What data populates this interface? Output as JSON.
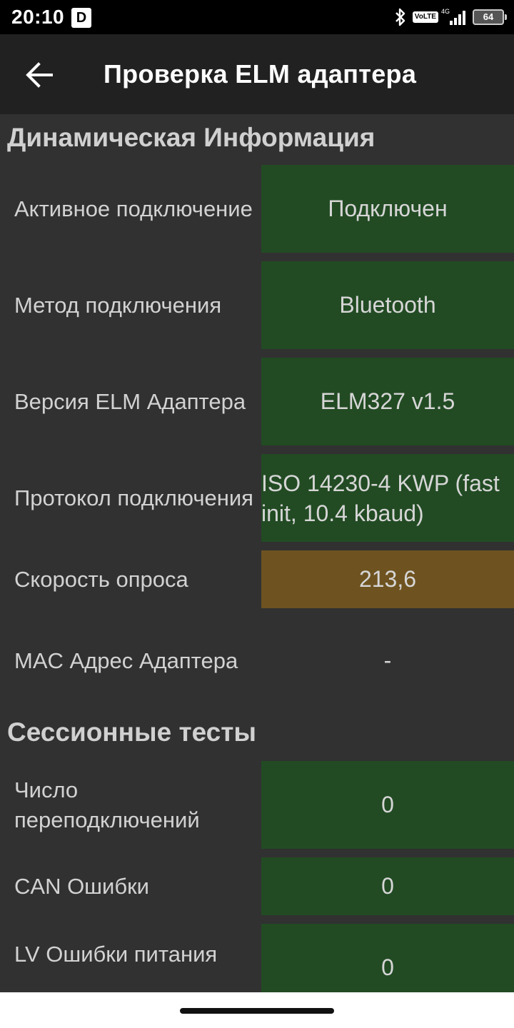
{
  "status_bar": {
    "time": "20:10",
    "notification_letter": "D",
    "volte": "VoLTE",
    "network": "4G",
    "battery": "64"
  },
  "app_bar": {
    "title": "Проверка ELM адаптера"
  },
  "sections": {
    "dynamic": {
      "heading": "Динамическая Информация",
      "rows": [
        {
          "label": "Активное подключение",
          "value": "Подключен"
        },
        {
          "label": "Метод подключения",
          "value": "Bluetooth"
        },
        {
          "label": "Версия ELM Адаптера",
          "value": "ELM327 v1.5"
        },
        {
          "label": "Протокол подключения",
          "value": "ISO 14230-4 KWP (fast init, 10.4 kbaud)"
        },
        {
          "label": "Скорость опроса",
          "value": "213,6"
        },
        {
          "label": "MAC Адрес Адаптера",
          "value": "-"
        }
      ]
    },
    "session": {
      "heading": "Сессионные тесты",
      "rows": [
        {
          "label": "Число переподключений",
          "value": "0"
        },
        {
          "label": "CAN Ошибки",
          "value": "0"
        },
        {
          "label": "LV Ошибки питания",
          "value": "0"
        }
      ]
    }
  },
  "colors": {
    "ok_green": "#224b23",
    "warn_amber": "#6e5320",
    "background": "#313131",
    "app_bar": "#212121"
  }
}
